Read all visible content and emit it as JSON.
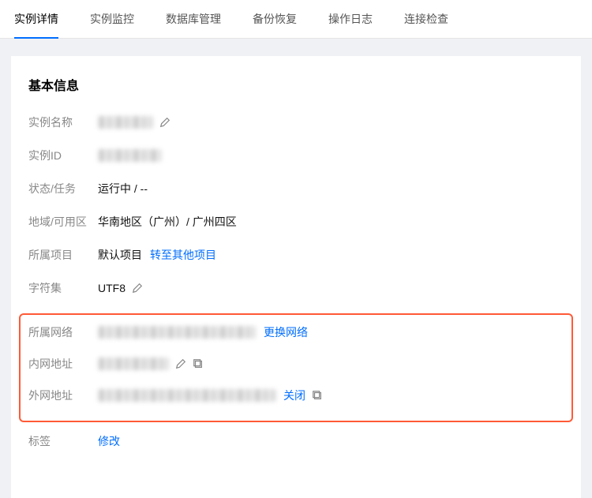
{
  "tabs": {
    "detail": "实例详情",
    "monitor": "实例监控",
    "db": "数据库管理",
    "backup": "备份恢复",
    "oplog": "操作日志",
    "conn": "连接检查"
  },
  "section": {
    "title": "基本信息"
  },
  "labels": {
    "name": "实例名称",
    "id": "实例ID",
    "status": "状态/任务",
    "region": "地域/可用区",
    "project": "所属项目",
    "charset": "字符集",
    "network": "所属网络",
    "intranet": "内网地址",
    "extranet": "外网地址",
    "tag": "标签"
  },
  "values": {
    "status": "运行中 / --",
    "region": "华南地区（广州）/ 广州四区",
    "project": "默认项目",
    "charset": "UTF8"
  },
  "links": {
    "switchProject": "转至其他项目",
    "switchNetwork": "更换网络",
    "closeExtranet": "关闭",
    "modify": "修改"
  }
}
